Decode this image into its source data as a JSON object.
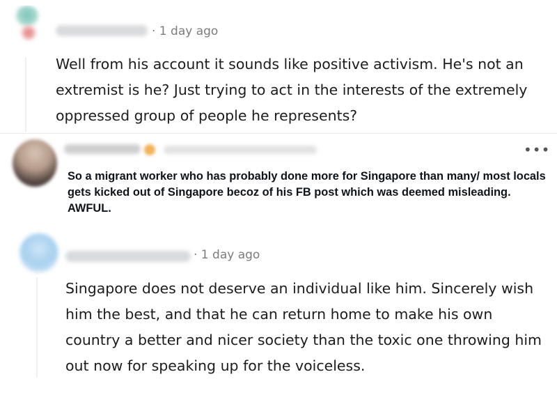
{
  "comments": [
    {
      "timestamp": "· 1 day ago",
      "body": "Well from his account it sounds like positive activism. He's not an extremist is he? Just trying to act in the interests of the extremely oppressed group of people he represents?"
    },
    {
      "timestamp": "· 1 day ago",
      "body": "Singapore does not deserve an individual like him. Sincerely wish him the best, and that he can return home to make his own country a better and nicer society than the toxic one throwing him out now for speaking up for the voiceless."
    }
  ],
  "tweet": {
    "more_icon": "•••",
    "body": "So a migrant worker who has probably done more for Singapore than many/ most locals gets kicked out of Singapore becoz of his FB post which was deemed misleading. AWFUL."
  },
  "icons": {
    "more": "more-options-icon"
  }
}
